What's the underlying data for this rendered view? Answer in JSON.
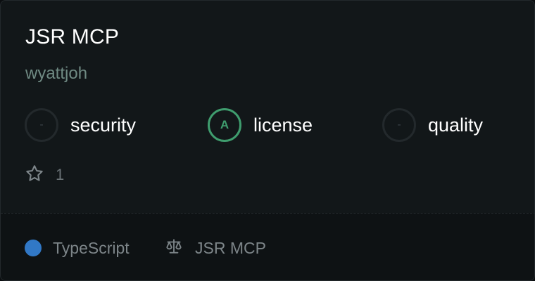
{
  "card": {
    "title": "JSR MCP",
    "author": "wyattjoh",
    "scores": [
      {
        "grade": "-",
        "label": "security"
      },
      {
        "grade": "A",
        "label": "license"
      },
      {
        "grade": "-",
        "label": "quality"
      }
    ],
    "stars": "1",
    "footer": {
      "language": "TypeScript",
      "license_name": "JSR MCP"
    }
  },
  "colors": {
    "background": "#121719",
    "footer_background": "#0e1214",
    "title": "#ffffff",
    "author": "#6f8a83",
    "grade_a": "#3f9d6e",
    "language_dot": "#3178c6",
    "muted_text": "#7d8589"
  },
  "icons": {
    "star": "star-outline-icon",
    "license": "scale-icon"
  }
}
